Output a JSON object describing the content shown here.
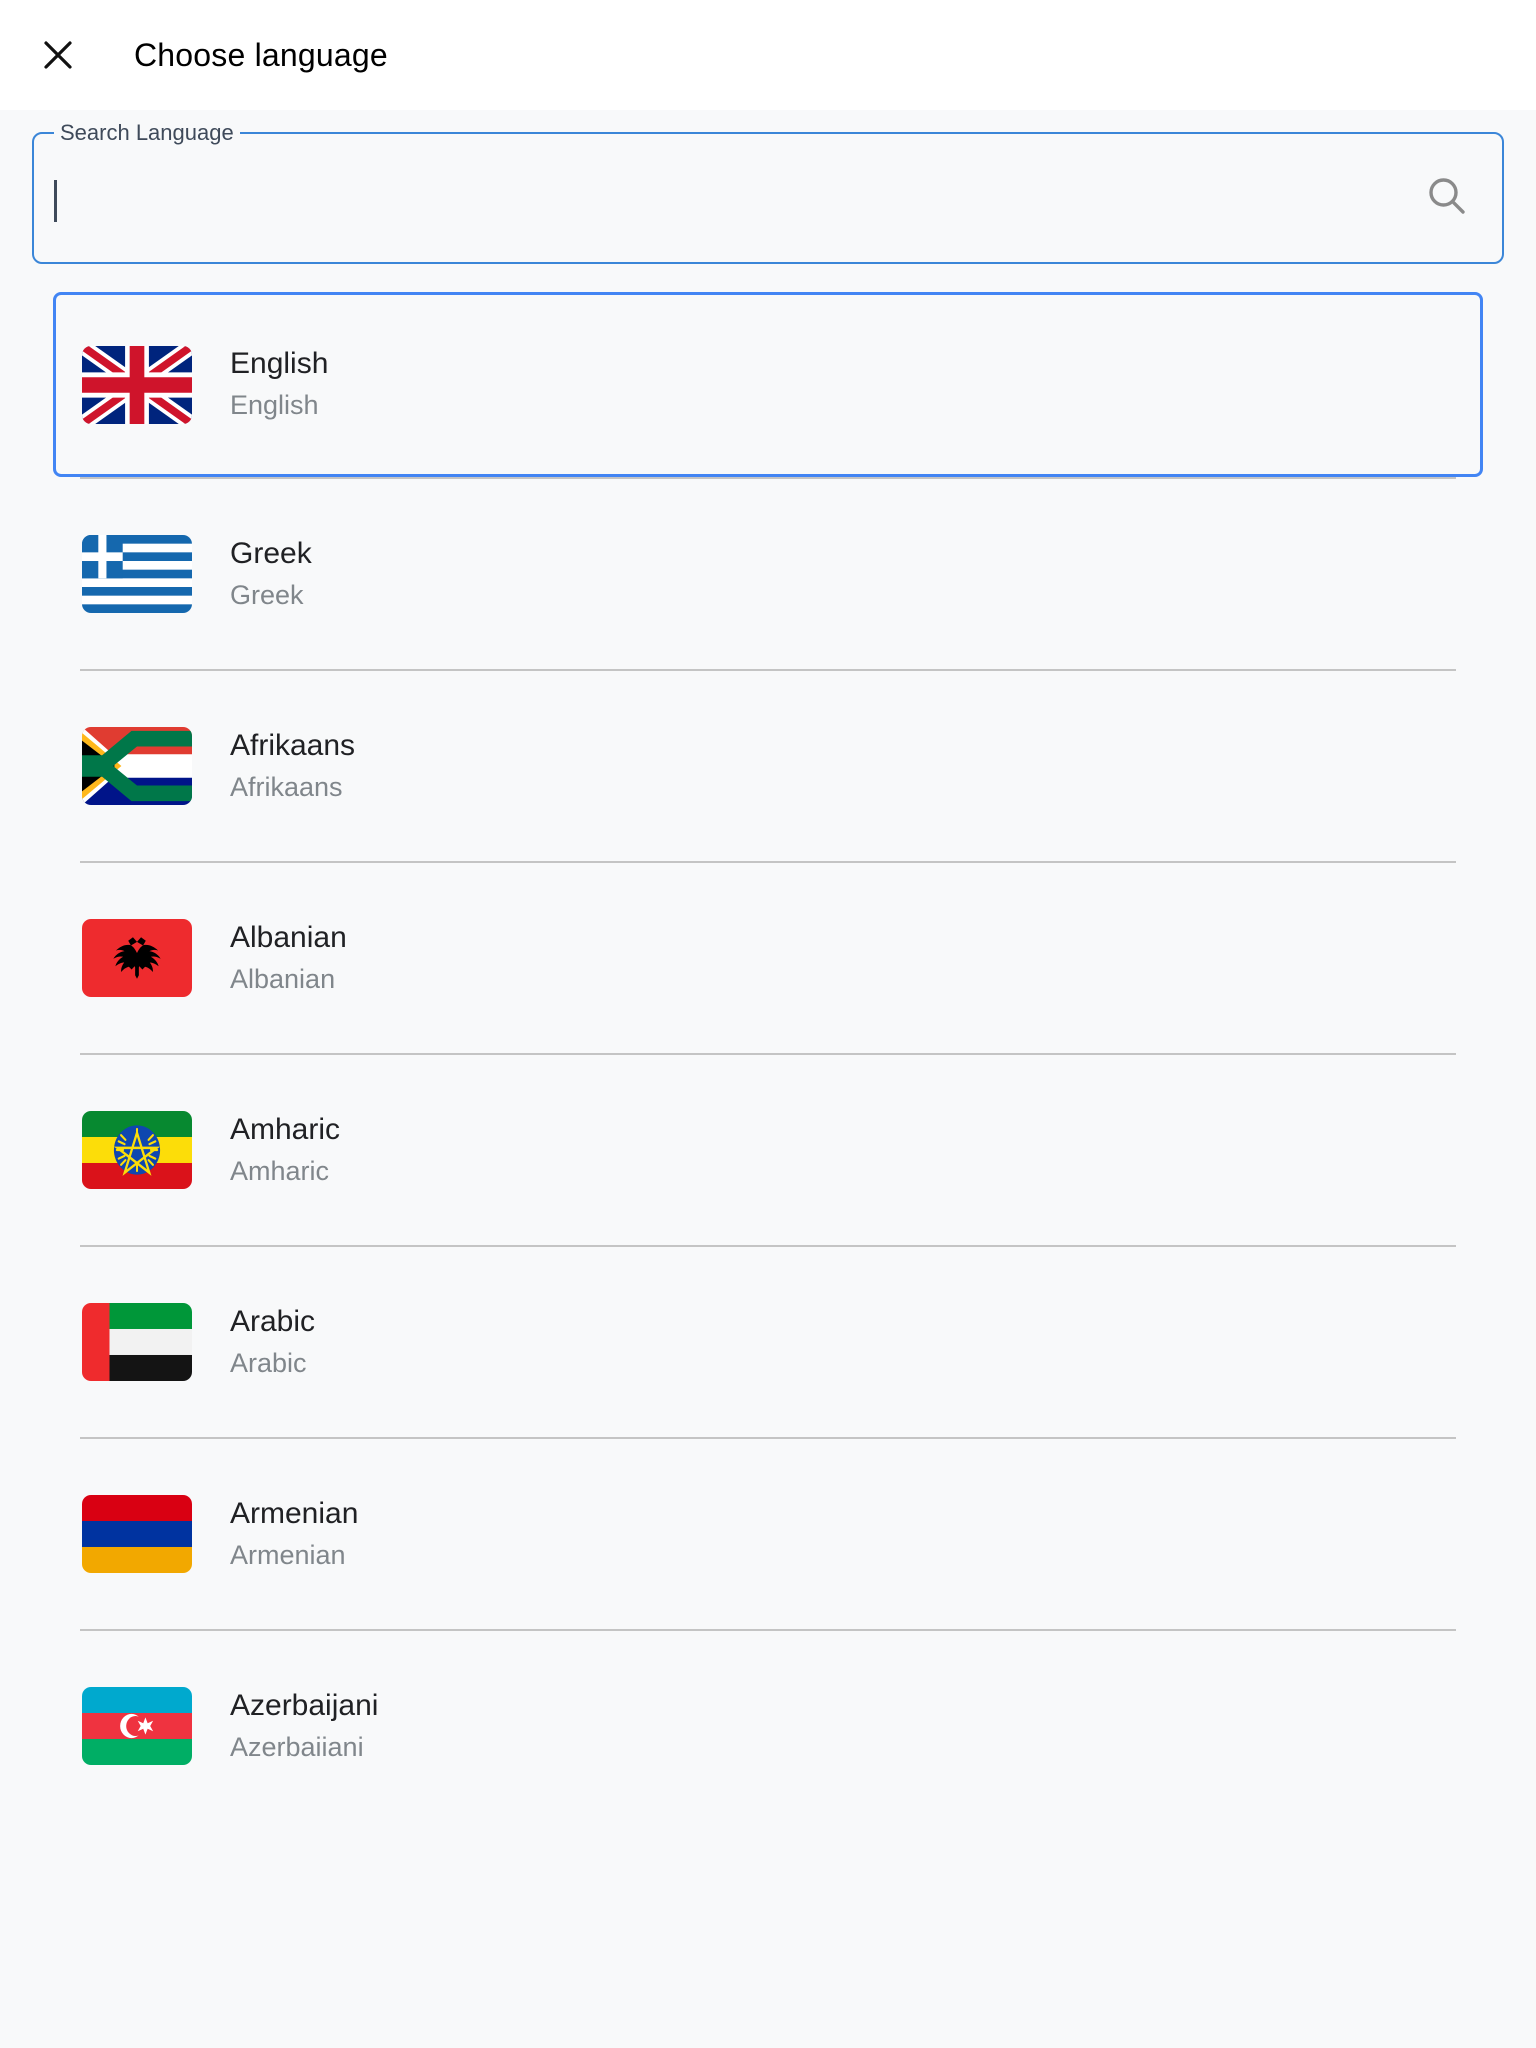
{
  "header": {
    "close_icon": "close-icon",
    "title": "Choose language"
  },
  "search": {
    "label": "Search Language",
    "value": "",
    "placeholder": "",
    "icon": "search-icon"
  },
  "colors": {
    "accent": "#4285f4",
    "field_border": "#3b86d8",
    "page_bg": "#f8f9fa",
    "appbar_bg": "#ffffff",
    "label": "#3f4a5a",
    "primary_text": "#202124",
    "secondary_text": "#80868b",
    "divider": "#c4c4c4"
  },
  "languages": [
    {
      "name": "English",
      "native": "English",
      "flag": "flag-united-kingdom",
      "selected": true
    },
    {
      "name": "Greek",
      "native": "Greek",
      "flag": "flag-greece",
      "selected": false
    },
    {
      "name": "Afrikaans",
      "native": "Afrikaans",
      "flag": "flag-south-africa",
      "selected": false
    },
    {
      "name": "Albanian",
      "native": "Albanian",
      "flag": "flag-albania",
      "selected": false
    },
    {
      "name": "Amharic",
      "native": "Amharic",
      "flag": "flag-ethiopia",
      "selected": false
    },
    {
      "name": "Arabic",
      "native": "Arabic",
      "flag": "flag-united-arab-emirates",
      "selected": false
    },
    {
      "name": "Armenian",
      "native": "Armenian",
      "flag": "flag-armenia",
      "selected": false
    },
    {
      "name": "Azerbaijani",
      "native": "Azerbaiiani",
      "flag": "flag-azerbaijan",
      "selected": false
    }
  ]
}
